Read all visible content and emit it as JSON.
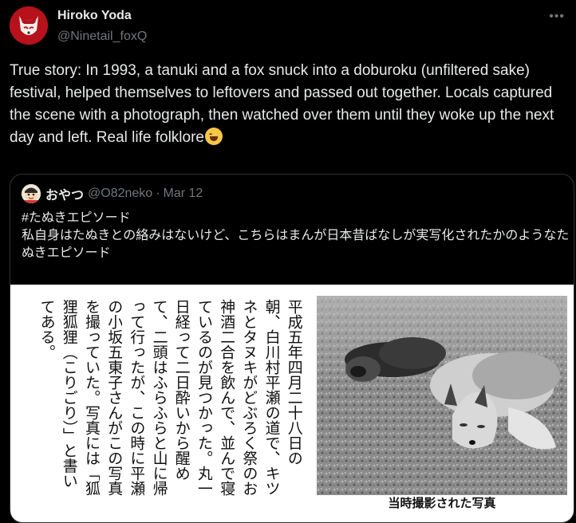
{
  "author": {
    "name": "Hiroko Yoda",
    "handle": "@Ninetail_foxQ",
    "avatar": "fox-mask-avatar"
  },
  "more_icon": "more-icon",
  "post_text": "True story: In 1993, a tanuki and a fox snuck into a doburoku (unfiltered sake) festival, helped themselves to leftovers and passed out together. Locals captured the scene with a photograph, then watched over them until they woke up the next day and left. Real life folklore",
  "post_emoji": "rolling-on-floor-laughing-emoji",
  "quoted": {
    "name": "おやつ",
    "handle": "@O82neko",
    "dot": "·",
    "date": "Mar 12",
    "hashtag": "#たぬきエピソード",
    "text": "私自身はたぬきとの絡みはないけど、こちらはまんが日本昔ばなしが実写化されたかのようなたぬきエピソード",
    "image": {
      "columns": [
        "平成五年四月二十八日の",
        "朝、白川村平瀬の道で、キツ",
        "ネとタヌキがどぶろく祭のお",
        "神酒二合を飲んで、並んで寝",
        "ているのが見つかった。丸一",
        "日経って二日酔いから醒め",
        "て、二頭はふらふらと山に帰",
        "って行ったが、この時に平瀬",
        "の小坂五東子さんがこの写真",
        "を撮っていた。写真には「狐",
        "狸狐狸（こりごり）」と書い",
        "てある。"
      ],
      "caption": "当時撮影された写真"
    }
  },
  "colors": {
    "background": "#000000",
    "text": "#e7e9ea",
    "muted": "#71767b",
    "border": "#2f3336"
  }
}
